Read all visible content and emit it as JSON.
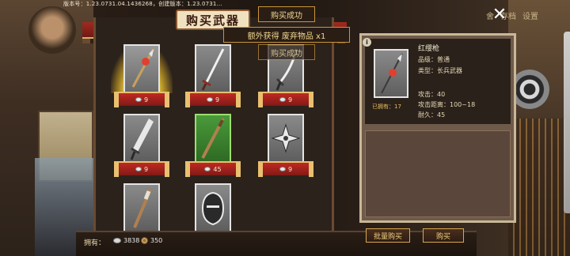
{
  "version_text": "版本号：1.23.0731.04.1436268，创建版本：1.23.0731...",
  "background_tabs": [
    "舍",
    "存档",
    "设置"
  ],
  "shop": {
    "title": "购买武器",
    "items": [
      {
        "name": "红缨枪",
        "price": "9",
        "weapon": "spear-icon",
        "highlight": "gold"
      },
      {
        "name": "",
        "price": "9",
        "weapon": "sword-icon",
        "highlight": ""
      },
      {
        "name": "",
        "price": "9",
        "weapon": "saber-icon",
        "highlight": ""
      },
      {
        "name": "",
        "price": "9",
        "weapon": "broadsword-icon",
        "highlight": ""
      },
      {
        "name": "",
        "price": "45",
        "weapon": "staff-icon",
        "highlight": "selected"
      },
      {
        "name": "",
        "price": "9",
        "weapon": "shuriken-icon",
        "highlight": ""
      },
      {
        "name": "",
        "price": "",
        "weapon": "club-icon",
        "highlight": ""
      },
      {
        "name": "",
        "price": "",
        "weapon": "mask-icon",
        "highlight": ""
      }
    ]
  },
  "messages": {
    "purchase_success_1": "购买成功",
    "extra_gain": "额外获得 废弃物品 x1",
    "purchase_success_2": "购买成功"
  },
  "detail": {
    "name": "红缨枪",
    "quality_label": "品级：",
    "quality_value": "普通",
    "type_label": "类型：",
    "type_value": "长兵武器",
    "owned_label": "已拥有：",
    "owned_value": "17",
    "attack_label": "攻击：",
    "attack_value": "40",
    "range_label": "攻击距离：",
    "range_value": "100~18",
    "durability_label": "耐久：",
    "durability_value": "45"
  },
  "wallet": {
    "label": "拥有：",
    "silver": "3838",
    "copper": "350"
  },
  "buttons": {
    "bulk_buy": "批量购买",
    "buy": "购买",
    "close": "✕"
  },
  "colors": {
    "accent_gold": "#d8a850",
    "banner_red": "#c02a22",
    "selected_green": "#4a9a3a"
  }
}
